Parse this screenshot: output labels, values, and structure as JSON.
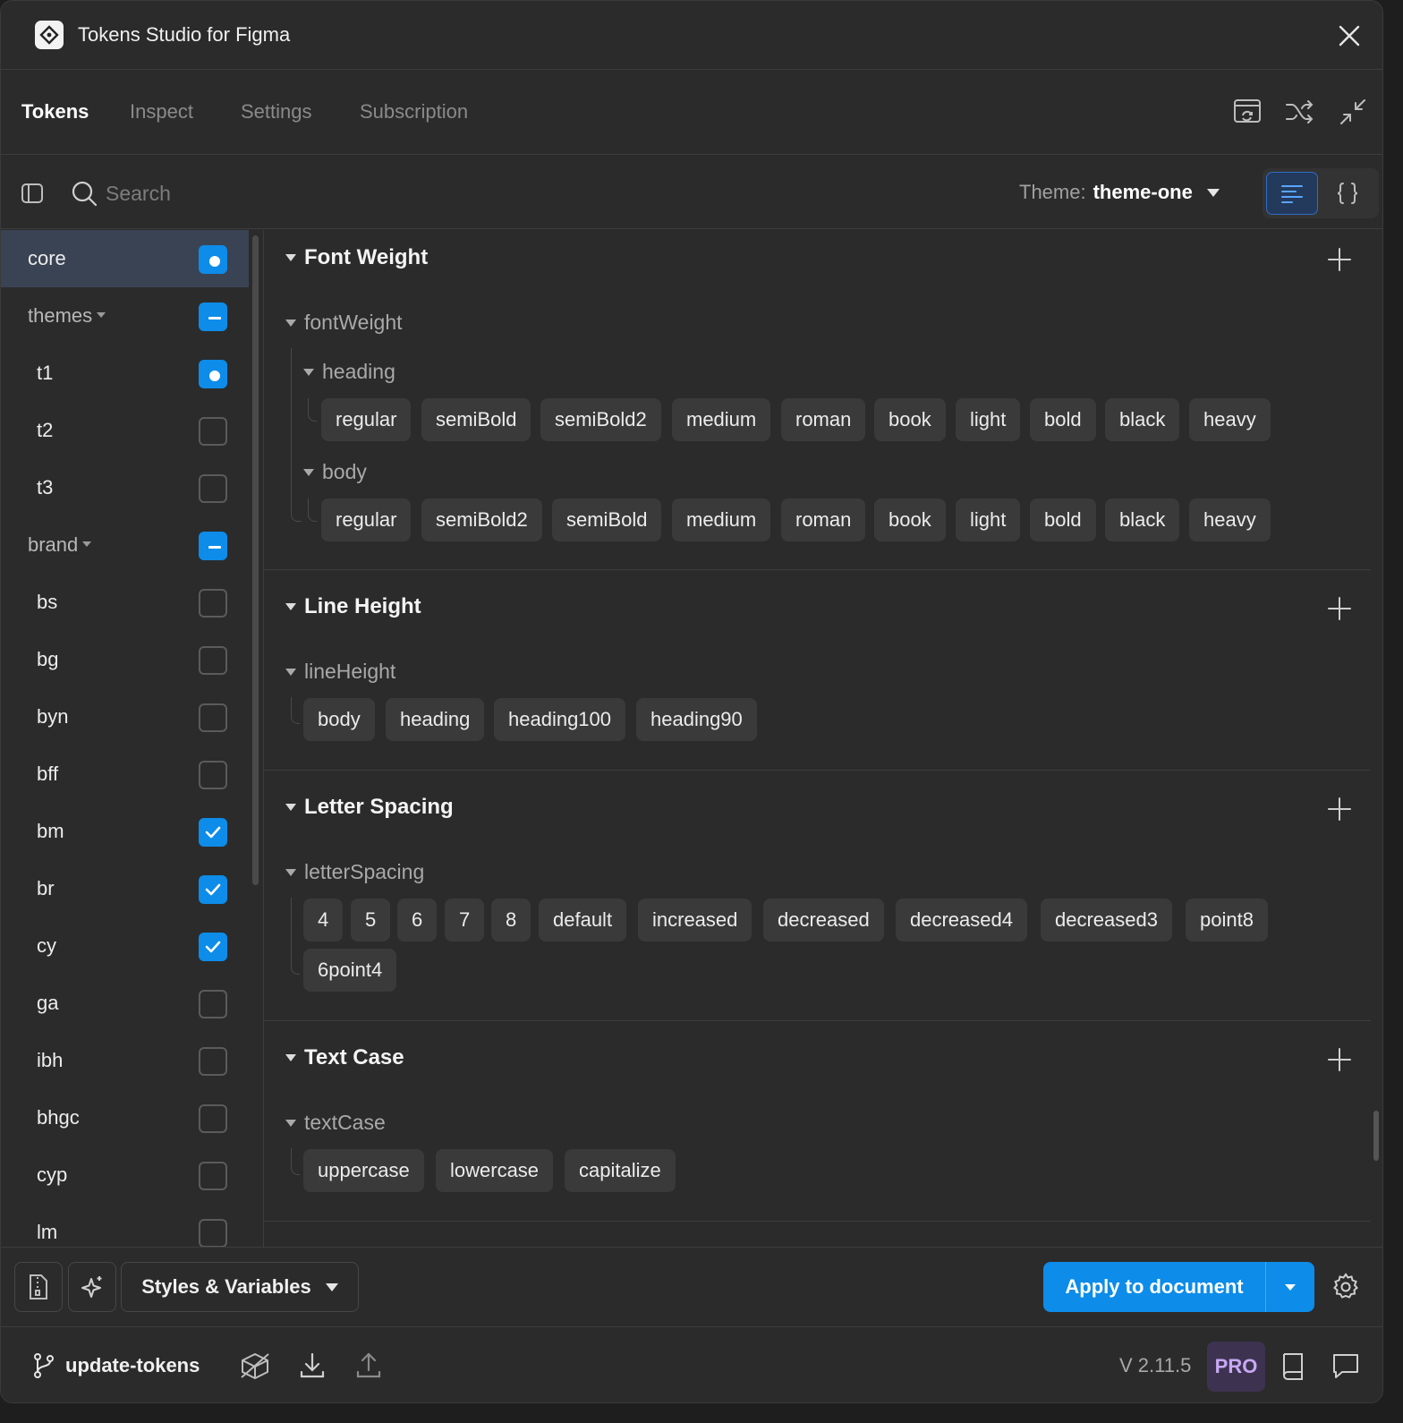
{
  "window": {
    "title": "Tokens Studio for Figma"
  },
  "tabs": [
    {
      "label": "Tokens",
      "active": true
    },
    {
      "label": "Inspect",
      "active": false
    },
    {
      "label": "Settings",
      "active": false
    },
    {
      "label": "Subscription",
      "active": false
    }
  ],
  "toolbar_icons": [
    "file-preview-icon",
    "shuffle-icon",
    "minimize-icon"
  ],
  "search": {
    "placeholder": "Search",
    "value": ""
  },
  "theme": {
    "label": "Theme:",
    "value": "theme-one"
  },
  "view_modes": [
    "list-view-icon",
    "json-view-icon"
  ],
  "sidebar": {
    "items": [
      {
        "label": "core",
        "type": "set",
        "state": "source"
      },
      {
        "label": "themes",
        "type": "group",
        "state": "partial"
      },
      {
        "label": "t1",
        "type": "set",
        "state": "source"
      },
      {
        "label": "t2",
        "type": "set",
        "state": "off"
      },
      {
        "label": "t3",
        "type": "set",
        "state": "off"
      },
      {
        "label": "brand",
        "type": "group",
        "state": "partial"
      },
      {
        "label": "bs",
        "type": "set",
        "state": "off"
      },
      {
        "label": "bg",
        "type": "set",
        "state": "off"
      },
      {
        "label": "byn",
        "type": "set",
        "state": "off"
      },
      {
        "label": "bff",
        "type": "set",
        "state": "off"
      },
      {
        "label": "bm",
        "type": "set",
        "state": "checked"
      },
      {
        "label": "br",
        "type": "set",
        "state": "checked"
      },
      {
        "label": "cy",
        "type": "set",
        "state": "checked"
      },
      {
        "label": "ga",
        "type": "set",
        "state": "off"
      },
      {
        "label": "ibh",
        "type": "set",
        "state": "off"
      },
      {
        "label": "bhgc",
        "type": "set",
        "state": "off"
      },
      {
        "label": "cyp",
        "type": "set",
        "state": "off"
      },
      {
        "label": "lm",
        "type": "set",
        "state": "off"
      }
    ]
  },
  "sections": {
    "font_weight": {
      "title": "Font Weight",
      "group": "fontWeight",
      "heading": {
        "label": "heading",
        "tokens": [
          "regular",
          "semiBold",
          "semiBold2",
          "medium",
          "roman",
          "book",
          "light",
          "bold",
          "black",
          "heavy"
        ]
      },
      "body": {
        "label": "body",
        "tokens": [
          "regular",
          "semiBold2",
          "semiBold",
          "medium",
          "roman",
          "book",
          "light",
          "bold",
          "black",
          "heavy"
        ]
      }
    },
    "line_height": {
      "title": "Line Height",
      "group": "lineHeight",
      "tokens": [
        "body",
        "heading",
        "heading100",
        "heading90"
      ]
    },
    "letter_spacing": {
      "title": "Letter Spacing",
      "group": "letterSpacing",
      "tokens": [
        "4",
        "5",
        "6",
        "7",
        "8",
        "default",
        "increased",
        "decreased",
        "decreased4",
        "decreased3",
        "point8",
        "6point4"
      ]
    },
    "text_case": {
      "title": "Text Case",
      "group": "textCase",
      "tokens": [
        "uppercase",
        "lowercase",
        "capitalize"
      ]
    }
  },
  "footer": {
    "styles_button": "Styles & Variables",
    "apply_button": "Apply to document",
    "branch": "update-tokens",
    "version": "V 2.11.5",
    "badge": "PRO"
  },
  "colors": {
    "accent": "#0d8ce9",
    "background": "#2b2b2b",
    "pill": "#3a3a3a",
    "pro_badge": "#3d3350"
  }
}
